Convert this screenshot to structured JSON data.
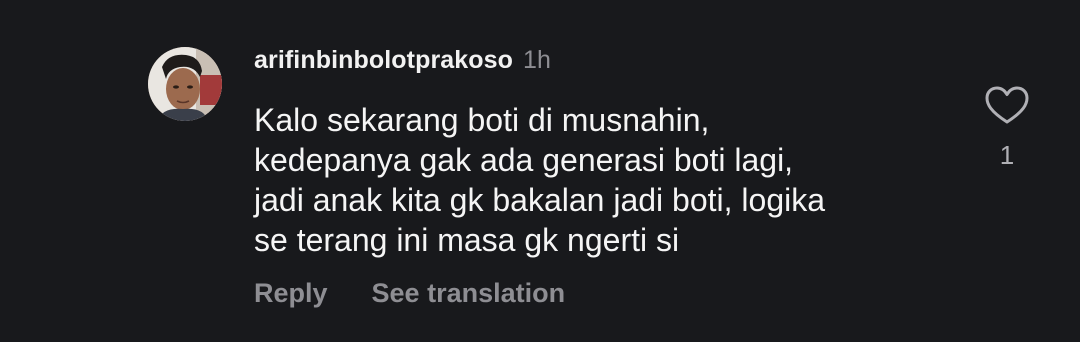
{
  "comment": {
    "username": "arifinbinbolotprakoso",
    "time": "1h",
    "text_lines": [
      "Kalo sekarang boti di musnahin,",
      "kedepanya gak ada generasi boti lagi,",
      "jadi anak kita gk bakalan jadi boti, logika",
      "se terang ini masa gk ngerti si"
    ],
    "likes": "1",
    "actions": {
      "reply_label": "Reply",
      "translate_label": "See translation"
    },
    "icons": {
      "like": "heart-outline-icon",
      "avatar": "profile-photo"
    },
    "colors": {
      "background": "#18191c",
      "primary_text": "#f5f5f5",
      "secondary_text": "#8e8e93"
    }
  }
}
